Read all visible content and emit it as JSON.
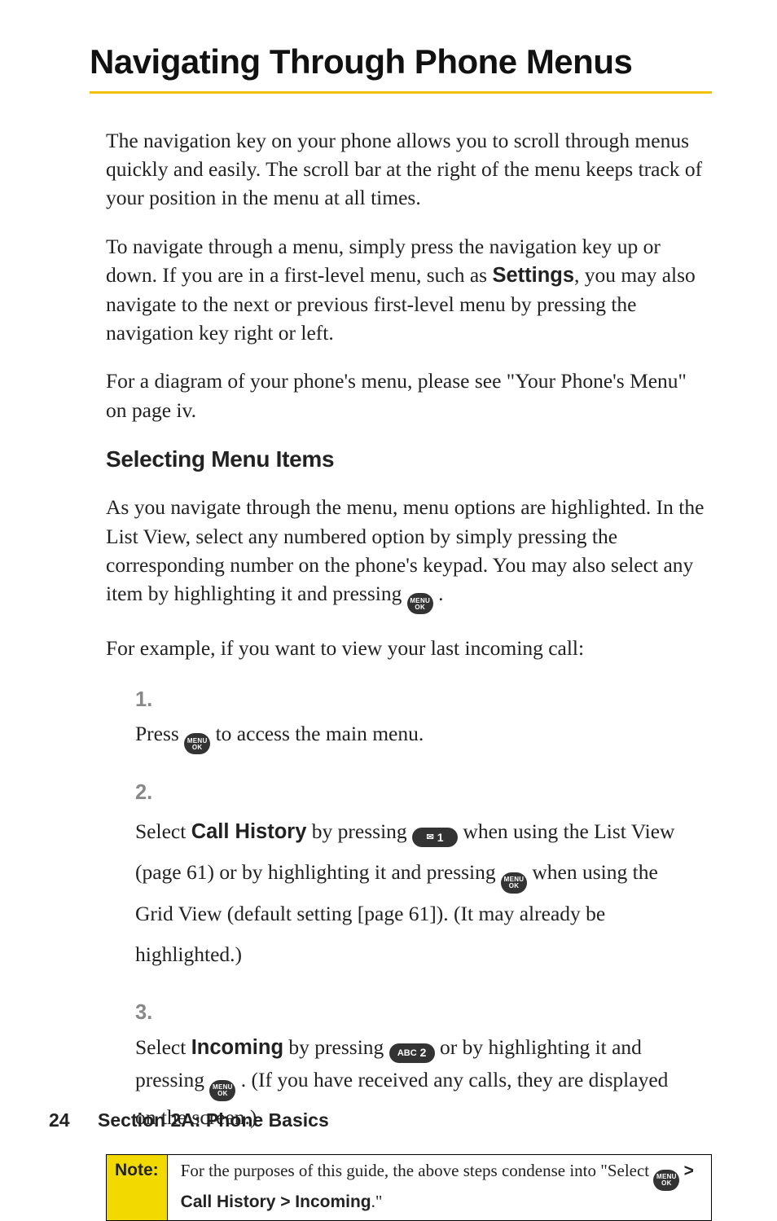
{
  "title": "Navigating Through Phone Menus",
  "paras": {
    "p1": "The navigation key on your phone allows you to scroll through menus quickly and easily. The scroll bar at the right of the menu keeps track of your position in the menu at all times.",
    "p2a": "To navigate through a menu, simply press the navigation key up or down. If you are in a first-level menu, such as ",
    "p2_bold": "Settings",
    "p2b": ", you may also navigate to the next or previous first-level menu by pressing the navigation key right or left.",
    "p3": "For a diagram of your phone's menu, please see \"Your Phone's Menu\" on page iv."
  },
  "subhead": "Selecting Menu Items",
  "sub_paras": {
    "sp1a": "As you navigate through the menu, menu options are highlighted. In the List View, select any numbered option by simply pressing the corresponding number on the phone's keypad. You may also select any item by highlighting it and pressing ",
    "sp1b": " .",
    "sp2": "For example, if you want to view your last incoming call:"
  },
  "steps": {
    "s1": {
      "num": "1.",
      "a": "Press ",
      "b": " to access the main menu."
    },
    "s2": {
      "num": "2.",
      "a": "Select ",
      "bold": "Call History",
      "b": " by pressing ",
      "c": " when using the List View (page 61) or by highlighting it and pressing ",
      "d": " when using the Grid View (default setting [page 61]). (It may already be highlighted.)"
    },
    "s3": {
      "num": "3.",
      "a": "Select ",
      "bold": "Incoming",
      "b": " by pressing ",
      "c": " or by highlighting it and pressing ",
      "d": " . (If you have received any calls, they are displayed on the screen.)"
    }
  },
  "icons": {
    "menu_l1": "MENU",
    "menu_l2": "OK",
    "key1_sym": "✉",
    "key1_num": "1",
    "key2_txt": "ABC",
    "key2_num": "2"
  },
  "note": {
    "label": "Note:",
    "a": "For the purposes of this guide, the above steps condense into \"Select ",
    "b": " ",
    "bold": "> Call History > Incoming",
    "c": ".\""
  },
  "footer": {
    "page": "24",
    "section": "Section 2A: Phone Basics"
  }
}
